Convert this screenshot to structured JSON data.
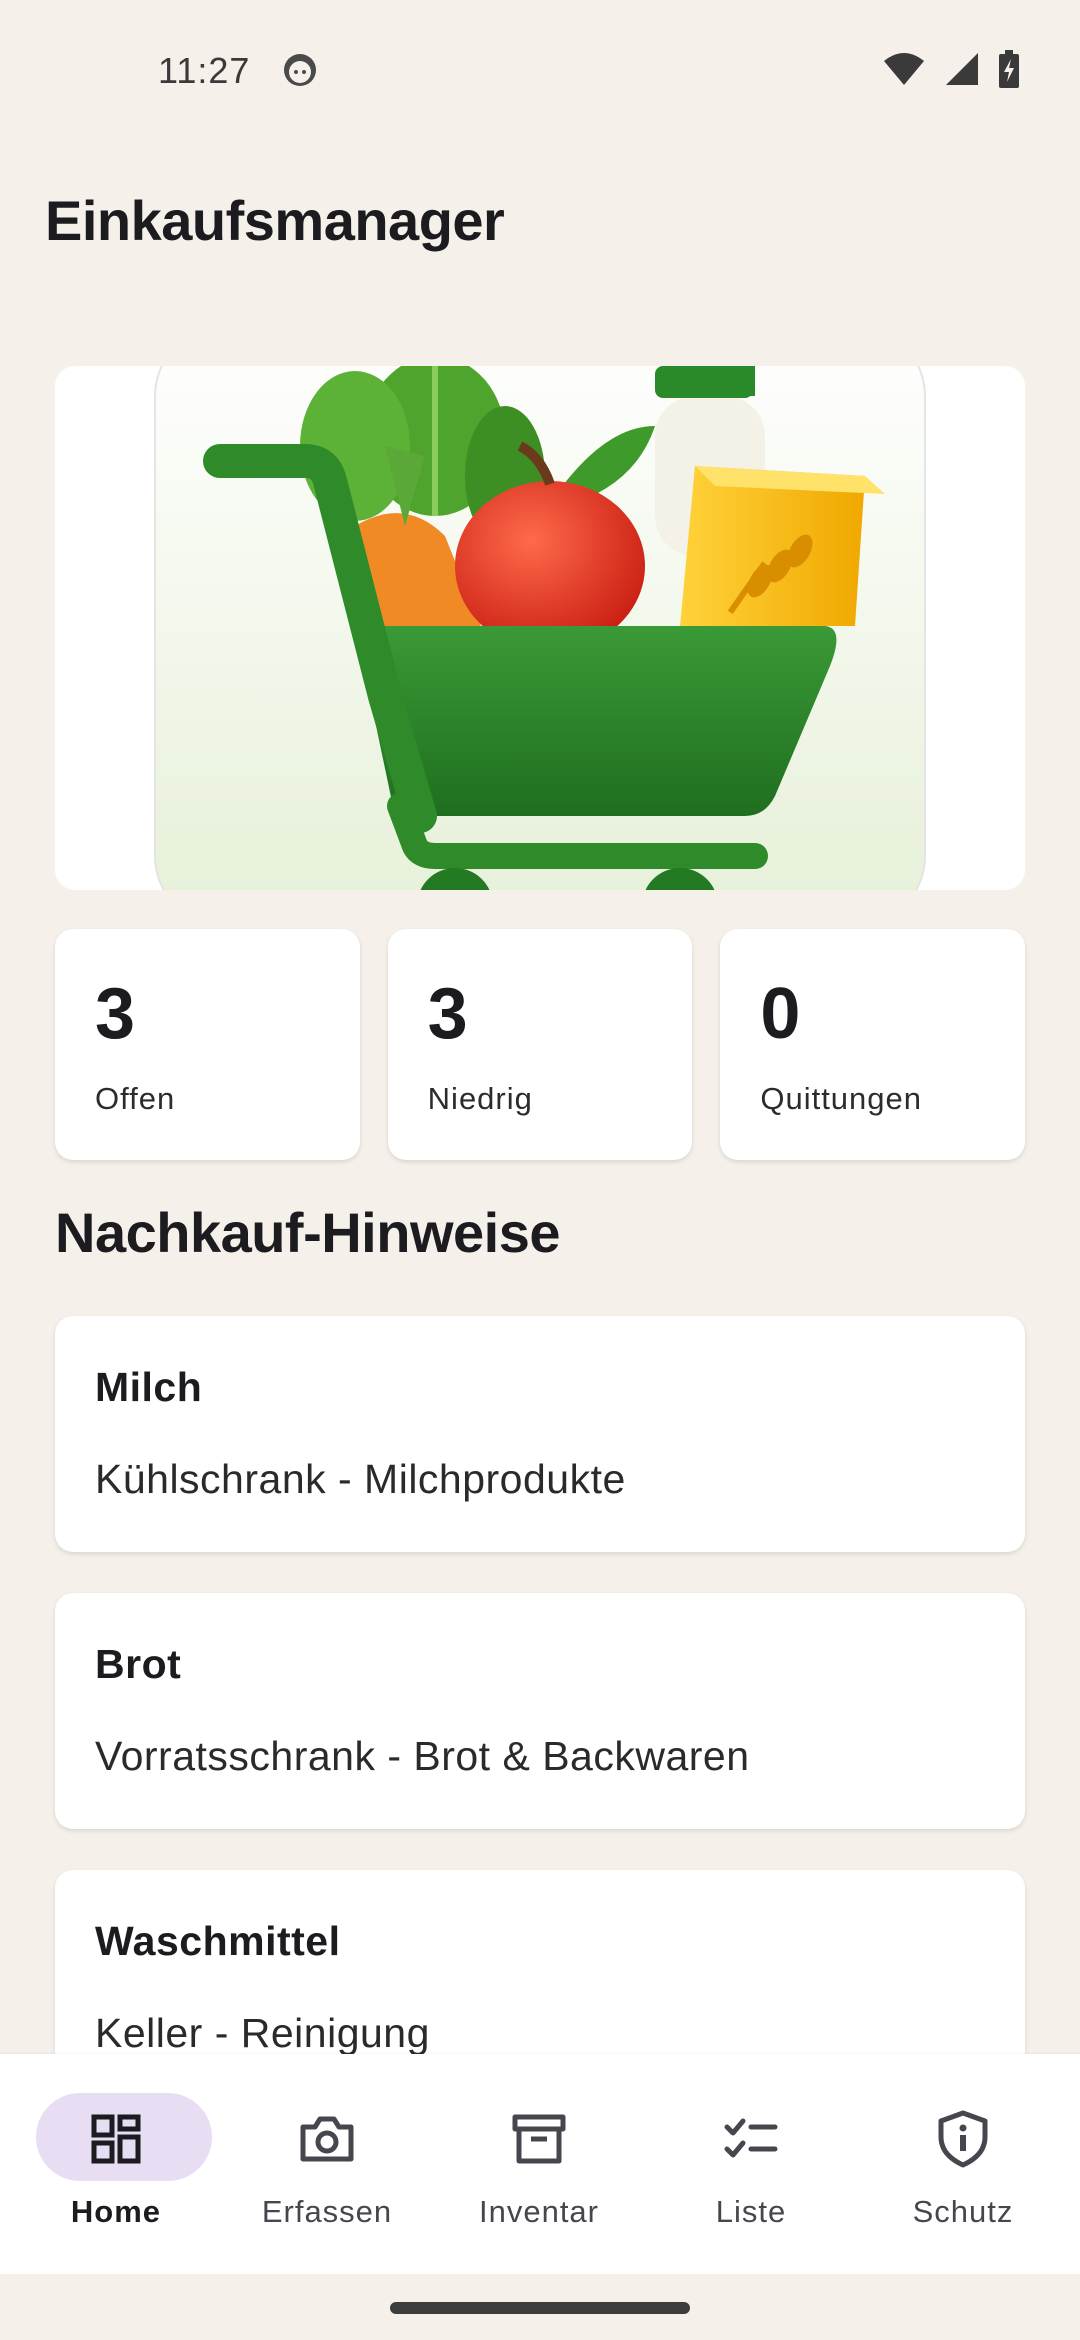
{
  "status_bar": {
    "time": "11:27",
    "icons": [
      "face-icon",
      "wifi-icon",
      "signal-icon",
      "battery-charging-icon"
    ]
  },
  "app": {
    "title": "Einkaufsmanager"
  },
  "hero": {
    "icon": "shopping-cart-with-groceries-illustration"
  },
  "stats": [
    {
      "value": "3",
      "label": "Offen"
    },
    {
      "value": "3",
      "label": "Niedrig"
    },
    {
      "value": "0",
      "label": "Quittungen"
    }
  ],
  "section": {
    "title": "Nachkauf-Hinweise"
  },
  "hints": [
    {
      "name": "Milch",
      "location": "Kühlschrank - Milchprodukte"
    },
    {
      "name": "Brot",
      "location": "Vorratsschrank - Brot & Backwaren"
    },
    {
      "name": "Waschmittel",
      "location": "Keller - Reinigung"
    }
  ],
  "nav": {
    "items": [
      {
        "label": "Home",
        "icon": "dashboard-icon",
        "active": true
      },
      {
        "label": "Erfassen",
        "icon": "camera-icon",
        "active": false
      },
      {
        "label": "Inventar",
        "icon": "archive-box-icon",
        "active": false
      },
      {
        "label": "Liste",
        "icon": "checklist-icon",
        "active": false
      },
      {
        "label": "Schutz",
        "icon": "shield-info-icon",
        "active": false
      }
    ]
  },
  "colors": {
    "background": "#f5f1ea",
    "card": "#ffffff",
    "nav_active_pill": "#e7def4",
    "cart_green": "#2e8b2e"
  }
}
